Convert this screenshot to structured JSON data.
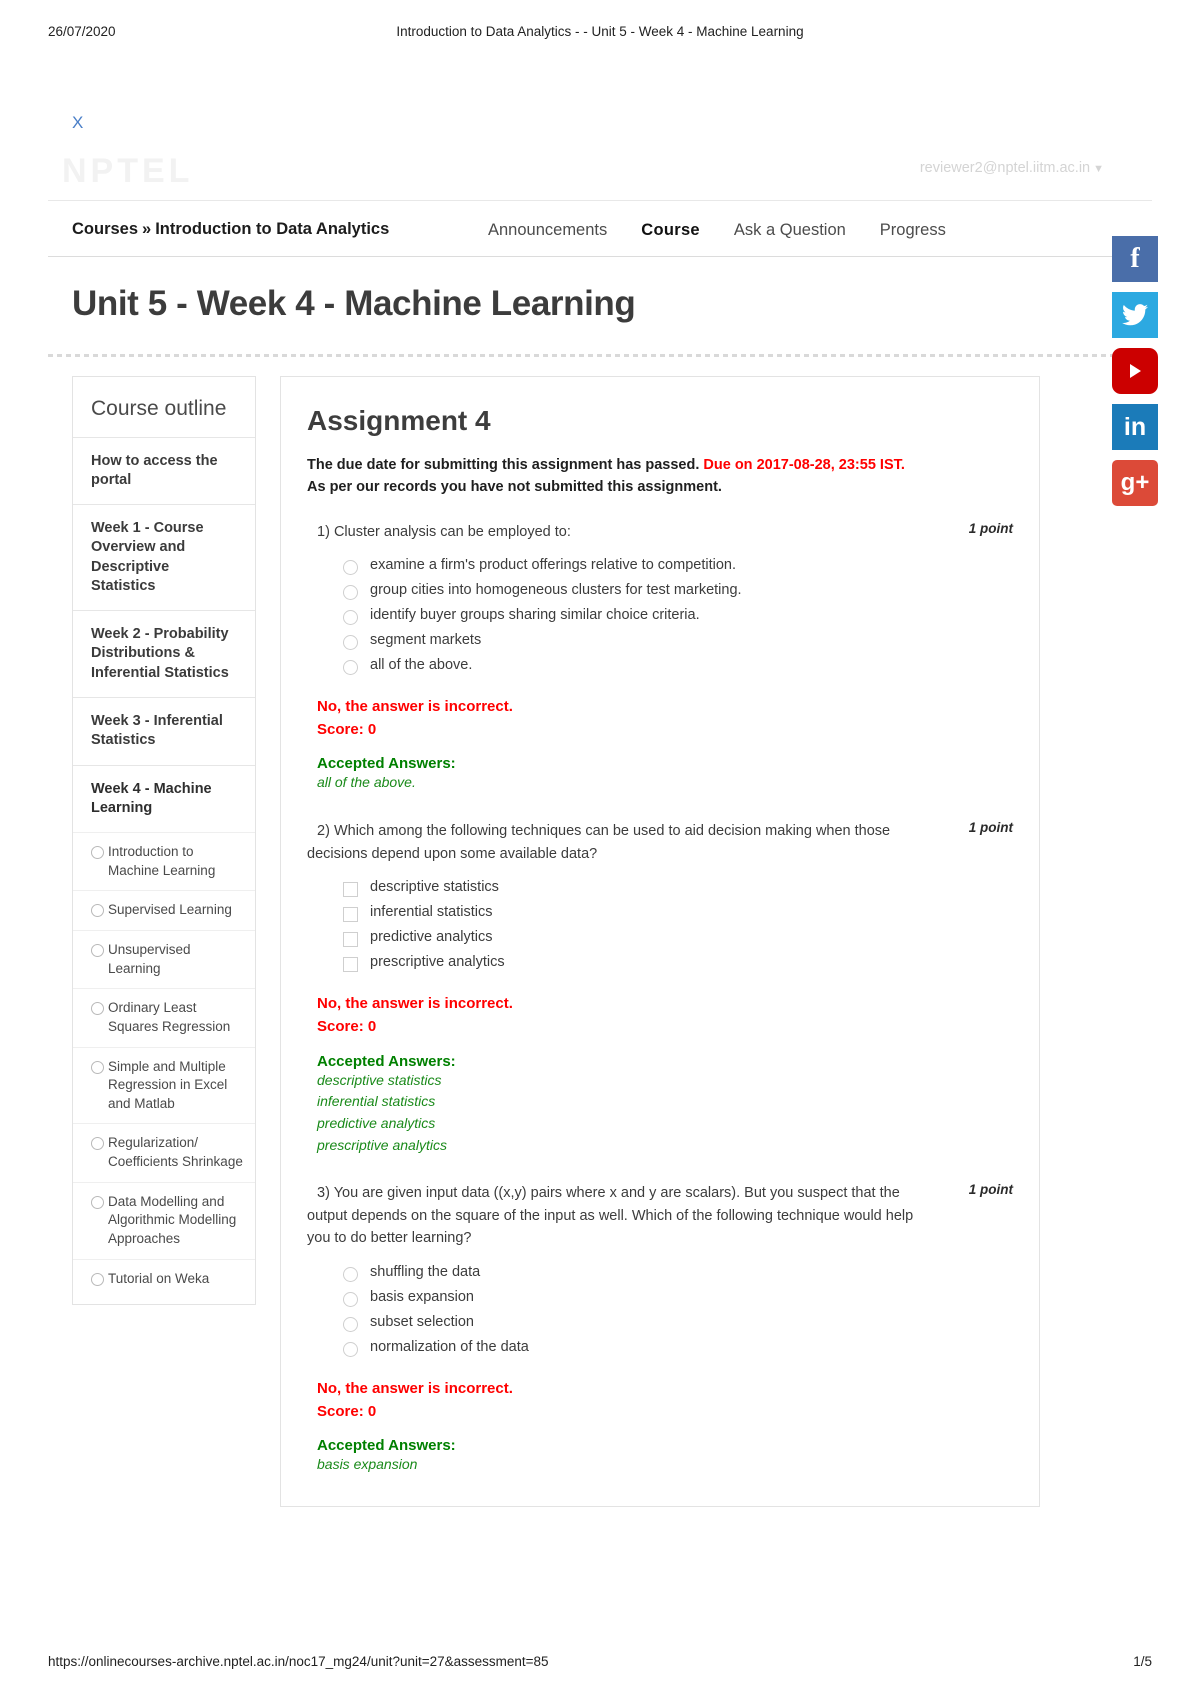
{
  "print": {
    "date": "26/07/2020",
    "title": "Introduction to Data Analytics - - Unit 5 - Week 4 - Machine Learning",
    "url": "https://onlinecourses-archive.nptel.ac.in/noc17_mg24/unit?unit=27&assessment=85",
    "page": "1/5"
  },
  "topbar": {
    "close_label": "X",
    "logo": "NPTEL",
    "account_email": "reviewer2@nptel.iitm.ac.in",
    "account_caret": "▼"
  },
  "nav": {
    "breadcrumb_root": "Courses",
    "breadcrumb_sep": "»",
    "breadcrumb_course": "Introduction to Data Analytics",
    "links": [
      {
        "label": "Announcements",
        "active": false
      },
      {
        "label": "Course",
        "active": true
      },
      {
        "label": "Ask a Question",
        "active": false
      },
      {
        "label": "Progress",
        "active": false
      }
    ]
  },
  "page_title": "Unit 5 - Week 4 - Machine Learning",
  "social": [
    {
      "name": "facebook",
      "glyph": "f",
      "color": "#4a6ea9"
    },
    {
      "name": "twitter",
      "glyph": "",
      "color": "#2ca9e1"
    },
    {
      "name": "youtube",
      "glyph": "",
      "color": "#cc0000"
    },
    {
      "name": "linkedin",
      "glyph": "in",
      "color": "#1b7bb9"
    },
    {
      "name": "googleplus",
      "glyph": "g+",
      "color": "#dc4a38"
    }
  ],
  "sidebar": {
    "title": "Course outline",
    "items": [
      {
        "label": "How to access the portal"
      },
      {
        "label": "Week 1 - Course Overview and Descriptive Statistics"
      },
      {
        "label": "Week 2 - Probability Distributions & Inferential Statistics"
      },
      {
        "label": "Week 3 - Inferential Statistics"
      },
      {
        "label": "Week 4 - Machine Learning"
      }
    ],
    "sub_items": [
      {
        "label": "Introduction to Machine Learning"
      },
      {
        "label": "Supervised Learning"
      },
      {
        "label": "Unsupervised Learning"
      },
      {
        "label": "Ordinary Least Squares Regression"
      },
      {
        "label": "Simple and Multiple Regression in Excel and Matlab"
      },
      {
        "label": "Regularization/ Coefficients Shrinkage"
      },
      {
        "label": "Data Modelling and Algorithmic Modelling Approaches"
      },
      {
        "label": "Tutorial on Weka"
      }
    ]
  },
  "main": {
    "assignment_title": "Assignment 4",
    "due_prefix": "The due date for submitting this assignment has passed.",
    "due_red": "Due on 2017-08-28, 23:55 IST.",
    "due_suffix": "As per our records you have not submitted this assignment.",
    "points_label": "1 point",
    "wrong_label": "No, the answer is incorrect.",
    "score_label": "Score: 0",
    "accepted_label": "Accepted Answers:",
    "questions": [
      {
        "number": "1)",
        "text": "Cluster analysis can be employed to:",
        "input_type": "radio",
        "points": "1 point",
        "options": [
          " examine a firm's product offerings relative to competition.",
          "group cities into homogeneous clusters for test marketing.",
          " identify buyer groups sharing similar choice criteria.",
          "segment markets",
          "all of the above."
        ],
        "feedback_wrong": "No, the answer is incorrect.",
        "feedback_score": "Score: 0",
        "accepted_answers": [
          "all of the above."
        ]
      },
      {
        "number": "2)",
        "text": "Which among the following techniques can be used to aid decision making when those decisions depend upon some available data?",
        "input_type": "checkbox",
        "points": "1 point",
        "options": [
          "descriptive statistics",
          "inferential statistics",
          "predictive analytics",
          "prescriptive analytics"
        ],
        "feedback_wrong": "No, the answer is incorrect.",
        "feedback_score": "Score: 0",
        "accepted_answers": [
          "descriptive statistics",
          "inferential statistics",
          "predictive analytics",
          "prescriptive analytics"
        ]
      },
      {
        "number": "3)",
        "text": "You are given input data ((x,y) pairs where x and y are scalars). But you suspect that the output depends on the square of the input as well. Which of the following technique would help you to do better learning?",
        "input_type": "radio",
        "points": "1 point",
        "options": [
          "shuffling the data",
          "basis expansion",
          " subset selection",
          "normalization of the data"
        ],
        "feedback_wrong": "No, the answer is incorrect.",
        "feedback_score": "Score: 0",
        "accepted_answers": [
          "basis expansion"
        ]
      }
    ]
  }
}
